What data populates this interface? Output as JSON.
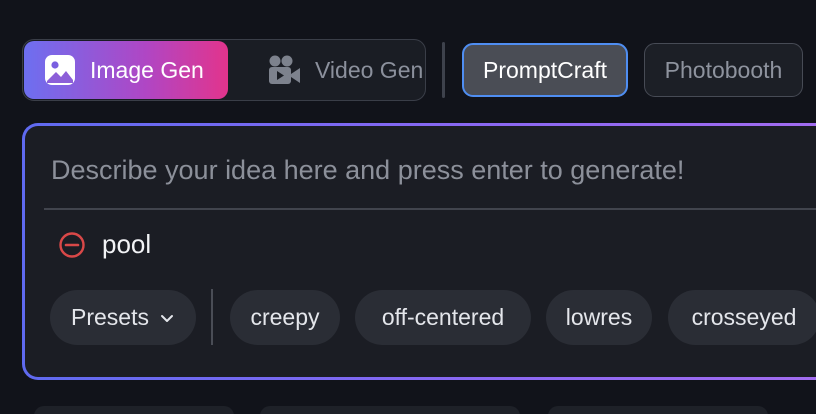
{
  "mode_toggle": {
    "image_gen_label": "Image Gen",
    "video_gen_label": "Video Gen"
  },
  "tabs": {
    "promptcraft_label": "PromptCraft",
    "photobooth_label": "Photobooth"
  },
  "prompt": {
    "placeholder": "Describe your idea here and press enter to generate!",
    "value": "",
    "negative_prompt": "pool"
  },
  "chips": {
    "presets_label": "Presets",
    "items": [
      "creepy",
      "off-centered",
      "lowres",
      "crosseyed"
    ]
  },
  "colors": {
    "accent_gradient_start": "#6d6ff0",
    "accent_gradient_end": "#e2348c",
    "active_tab_border": "#4f8ef2",
    "panel_border": "#8a68f2",
    "negative_icon": "#d94848"
  },
  "icons": {
    "image_gen": "image-icon",
    "video_gen": "video-camera-icon",
    "negative": "minus-circle-icon",
    "presets": "chevron-down-icon"
  }
}
